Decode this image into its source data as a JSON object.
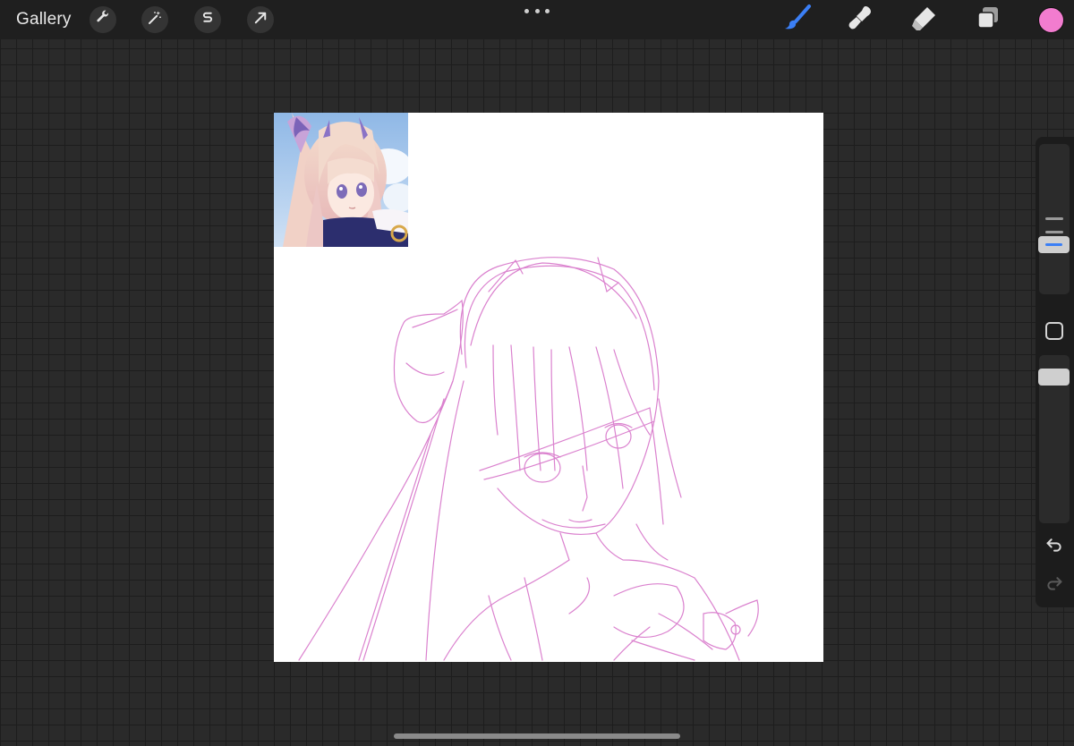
{
  "topbar": {
    "gallery_label": "Gallery",
    "left_tools": [
      "wrench-icon",
      "magic-wand-icon",
      "selection-s-icon",
      "transform-arrow-icon"
    ],
    "right_tools": [
      "brush-icon",
      "smudge-icon",
      "eraser-icon",
      "layers-icon"
    ],
    "active_tool": "brush-icon",
    "current_color": "#f27ccf"
  },
  "canvas": {
    "background": "#ffffff",
    "sketch_color": "#d774c9",
    "reference_image": "anime-character-reference"
  },
  "sidebar": {
    "brush_size_level": 0.67,
    "opacity_level": 0.1,
    "items": [
      "brush-size-slider",
      "modify-button",
      "opacity-slider",
      "undo-icon",
      "redo-icon"
    ],
    "accent": "#3b7ff5"
  },
  "colors": {
    "workspace": "#2a2a2a",
    "grid": "#1d1d1d",
    "topbar": "#1f1f1f",
    "brush_accent": "#3b7ff5"
  }
}
